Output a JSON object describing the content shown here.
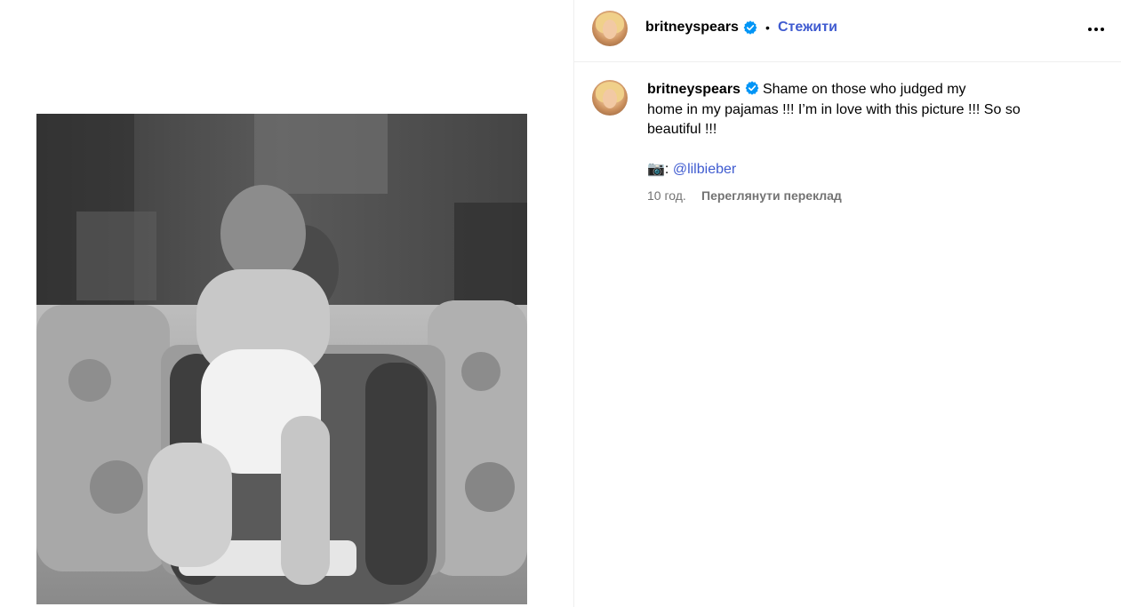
{
  "header": {
    "username": "britneyspears",
    "separator": "•",
    "follow_label": "Стежити"
  },
  "caption": {
    "username": "britneyspears",
    "line1": "Shame on those who judged my",
    "line2": "home in my pajamas !!! I’m in love with this picture !!! So so",
    "line3": "beautiful !!!",
    "camera_emoji": "📷",
    "camera_colon": ":",
    "mention": "@lilbieber",
    "time_ago": "10 год.",
    "translate_label": "Переглянути переклад"
  },
  "icons": {
    "verified": "verified-badge-icon",
    "more": "more-options-icon",
    "camera": "camera-icon"
  },
  "colors": {
    "link": "#3f5bd0",
    "verified": "#0095f6",
    "muted": "#737373",
    "divider": "#efefef"
  }
}
